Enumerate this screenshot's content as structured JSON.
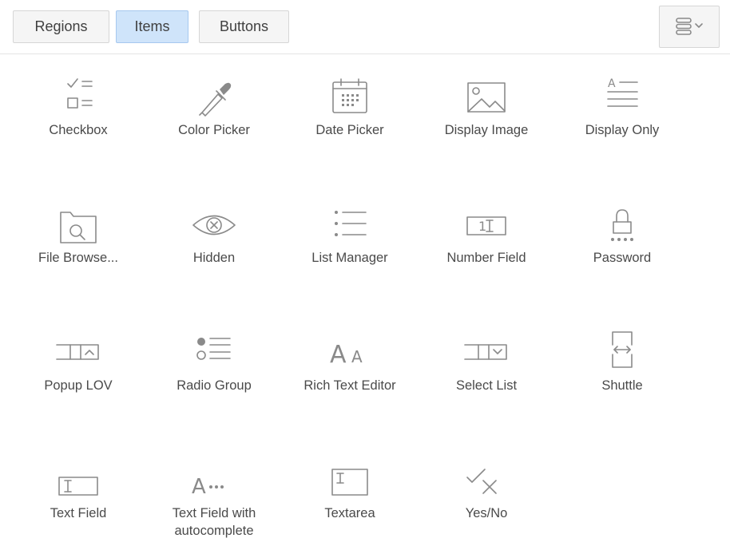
{
  "tabs": {
    "regions": "Regions",
    "items": "Items",
    "buttons": "Buttons",
    "active": "items"
  },
  "view_menu": {
    "icon": "list-view-icon"
  },
  "items": [
    {
      "label": "Checkbox",
      "icon": "checkbox-icon"
    },
    {
      "label": "Color Picker",
      "icon": "eyedropper-icon"
    },
    {
      "label": "Date Picker",
      "icon": "calendar-icon"
    },
    {
      "label": "Display Image",
      "icon": "image-icon"
    },
    {
      "label": "Display Only",
      "icon": "text-lines-icon"
    },
    {
      "label": "File Browse...",
      "icon": "folder-search-icon"
    },
    {
      "label": "Hidden",
      "icon": "hidden-eye-icon"
    },
    {
      "label": "List Manager",
      "icon": "bullet-list-icon"
    },
    {
      "label": "Number Field",
      "icon": "number-field-icon"
    },
    {
      "label": "Password",
      "icon": "lock-icon"
    },
    {
      "label": "Popup LOV",
      "icon": "popup-lov-icon"
    },
    {
      "label": "Radio Group",
      "icon": "radio-list-icon"
    },
    {
      "label": "Rich Text Editor",
      "icon": "font-size-icon"
    },
    {
      "label": "Select List",
      "icon": "select-list-icon"
    },
    {
      "label": "Shuttle",
      "icon": "shuttle-icon"
    },
    {
      "label": "Text Field",
      "icon": "text-field-icon"
    },
    {
      "label": "Text Field with autocomplete",
      "icon": "autocomplete-icon"
    },
    {
      "label": "Textarea",
      "icon": "textarea-icon"
    },
    {
      "label": "Yes/No",
      "icon": "check-cross-icon"
    }
  ],
  "colors": {
    "active_tab_bg": "#cfe4fa",
    "icon_stroke": "#8a8a8a",
    "text": "#404040"
  }
}
